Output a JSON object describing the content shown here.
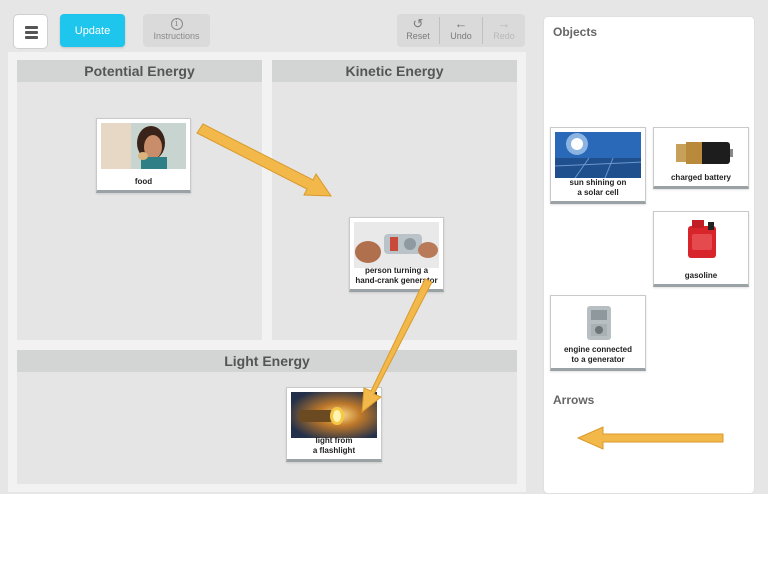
{
  "toolbar": {
    "update_label": "Update",
    "instructions_label": "Instructions",
    "reset_label": "Reset",
    "undo_label": "Undo",
    "redo_label": "Redo"
  },
  "zones": {
    "potential": "Potential Energy",
    "kinetic": "Kinetic Energy",
    "light": "Light Energy"
  },
  "placed_cards": {
    "food": "food",
    "crank": "person turning a\nhand-crank generator",
    "flashlight": "light from\na flashlight"
  },
  "panel": {
    "objects_title": "Objects",
    "arrows_title": "Arrows",
    "sun": "sun shining on\na solar cell",
    "battery": "charged battery",
    "gasoline": "gasoline",
    "engine": "engine connected\nto a generator"
  },
  "colors": {
    "accent": "#1ec6ee",
    "arrow": "#f3b84a",
    "arrow_stroke": "#d99a2b",
    "zone": "#e4e5e4",
    "zone_header": "#d3d5d4"
  },
  "icons": {
    "menu": "hamburger-icon",
    "instructions": "info-icon",
    "reset": "reset-icon",
    "undo": "undo-arrow-icon",
    "redo": "redo-arrow-icon"
  }
}
